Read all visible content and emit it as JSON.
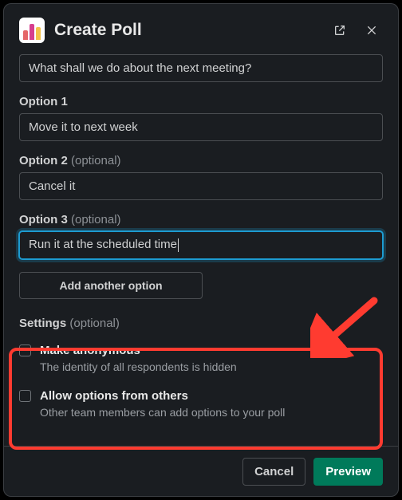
{
  "header": {
    "title": "Create Poll"
  },
  "question": {
    "value": "What shall we do about the next meeting?"
  },
  "options": [
    {
      "label": "Option 1",
      "optional": "",
      "value": "Move it to next week",
      "focused": false
    },
    {
      "label": "Option 2",
      "optional": " (optional)",
      "value": "Cancel it",
      "focused": false
    },
    {
      "label": "Option 3",
      "optional": " (optional)",
      "value": "Run it at the scheduled time",
      "focused": true
    }
  ],
  "addButton": "Add another option",
  "settings": {
    "heading": "Settings",
    "headingOptional": " (optional)",
    "items": [
      {
        "title": "Make anonymous",
        "desc": "The identity of all respondents is hidden",
        "checked": false
      },
      {
        "title": "Allow options from others",
        "desc": "Other team members can add options to your poll",
        "checked": false
      }
    ]
  },
  "footer": {
    "cancel": "Cancel",
    "preview": "Preview"
  }
}
